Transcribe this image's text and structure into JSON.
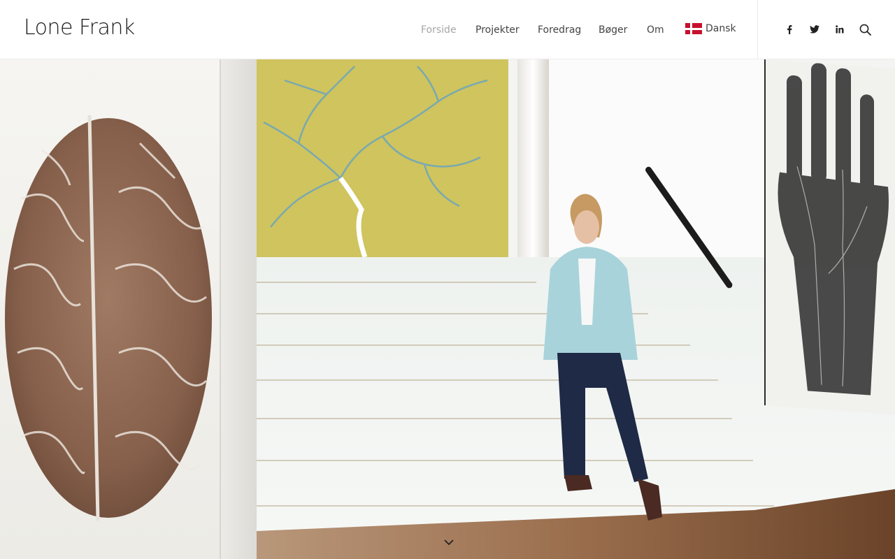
{
  "site": {
    "title": "Lone Frank"
  },
  "nav": {
    "items": [
      {
        "label": "Forside",
        "active": true
      },
      {
        "label": "Projekter",
        "active": false
      },
      {
        "label": "Foredrag",
        "active": false
      },
      {
        "label": "Bøger",
        "active": false
      },
      {
        "label": "Om",
        "active": false
      }
    ],
    "language": {
      "label": "Dansk",
      "flag": "denmark-flag-icon"
    }
  },
  "social": {
    "icons": [
      "facebook-icon",
      "twitter-icon",
      "linkedin-icon",
      "search-icon"
    ]
  },
  "hero": {
    "scroll_icon": "chevron-down-icon"
  },
  "colors": {
    "nav_active": "#a6a6a6",
    "nav_text": "#444444",
    "title": "#1b1b1b",
    "flag_red": "#c8102e"
  }
}
